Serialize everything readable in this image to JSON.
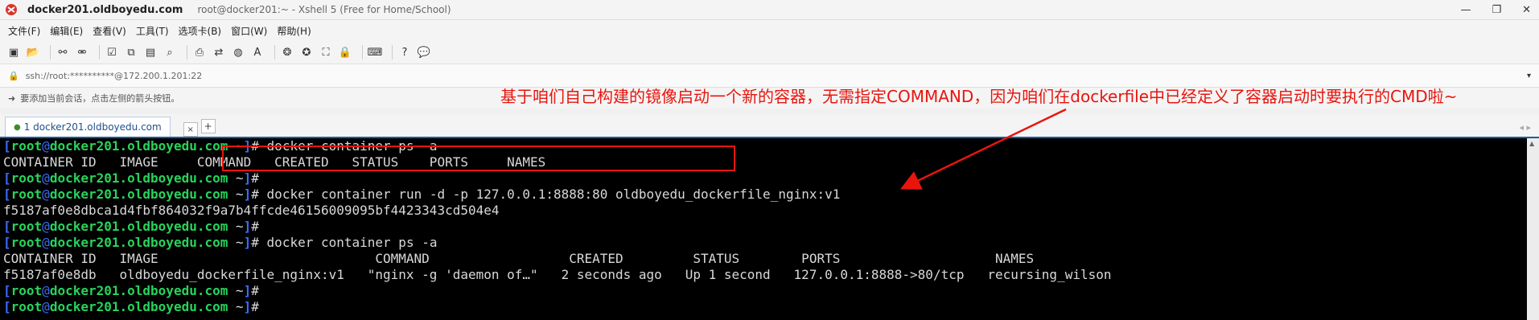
{
  "window": {
    "title": "docker201.oldboyedu.com",
    "subtitle": "root@docker201:~ - Xshell 5 (Free for Home/School)",
    "controls": [
      "—",
      "❐",
      "✕"
    ]
  },
  "menu": [
    "文件(F)",
    "编辑(E)",
    "查看(V)",
    "工具(T)",
    "选项卡(B)",
    "窗口(W)",
    "帮助(H)"
  ],
  "toolbar": {
    "icons": [
      "new-session-icon",
      "open-folder-icon",
      "reconnect-icon",
      "disconnect-icon",
      "properties-icon",
      "copy-icon",
      "paste-icon",
      "find-icon",
      "print-icon",
      "transfer-icon",
      "globe-icon",
      "font-icon",
      "xftp-icon",
      "xagent-icon",
      "fullscreen-icon",
      "lock-icon",
      "keyboard-icon",
      "help-icon",
      "chat-icon"
    ]
  },
  "address": {
    "text": "ssh://root:**********@172.200.1.201:22"
  },
  "hint": {
    "text": "要添加当前会话，点击左侧的箭头按钮。"
  },
  "annotation": {
    "text": "基于咱们自己构建的镜像启动一个新的容器，无需指定COMMAND，因为咱们在dockerfile中已经定义了容器启动时要执行的CMD啦~",
    "color": "#e8150e"
  },
  "tab": {
    "label": "1 docker201.oldboyedu.com",
    "close": "×",
    "add": "+",
    "nav": "◂ ▸"
  },
  "terminal": {
    "prompt_user": "root",
    "prompt_host": "docker201.oldboyedu.com",
    "prompt_path": "~",
    "lines": [
      {
        "type": "prompt",
        "cmd": "docker container ps -a"
      },
      {
        "type": "output",
        "text": "CONTAINER ID   IMAGE     COMMAND   CREATED   STATUS    PORTS     NAMES"
      },
      {
        "type": "prompt",
        "cmd": ""
      },
      {
        "type": "prompt",
        "cmd": "docker container run -d -p 127.0.0.1:8888:80 oldboyedu_dockerfile_nginx:v1"
      },
      {
        "type": "output",
        "text": "f5187af0e8dbca1d4fbf864032f9a7b4ffcde46156009095bf4423343cd504e4"
      },
      {
        "type": "prompt",
        "cmd": ""
      },
      {
        "type": "prompt",
        "cmd": "docker container ps -a"
      },
      {
        "type": "output",
        "text": "CONTAINER ID   IMAGE                            COMMAND                  CREATED         STATUS        PORTS                    NAMES"
      },
      {
        "type": "output",
        "text": "f5187af0e8db   oldboyedu_dockerfile_nginx:v1   \"nginx -g 'daemon of…\"   2 seconds ago   Up 1 second   127.0.0.1:8888->80/tcp   recursing_wilson"
      },
      {
        "type": "prompt",
        "cmd": ""
      },
      {
        "type": "prompt",
        "cmd": ""
      }
    ]
  }
}
